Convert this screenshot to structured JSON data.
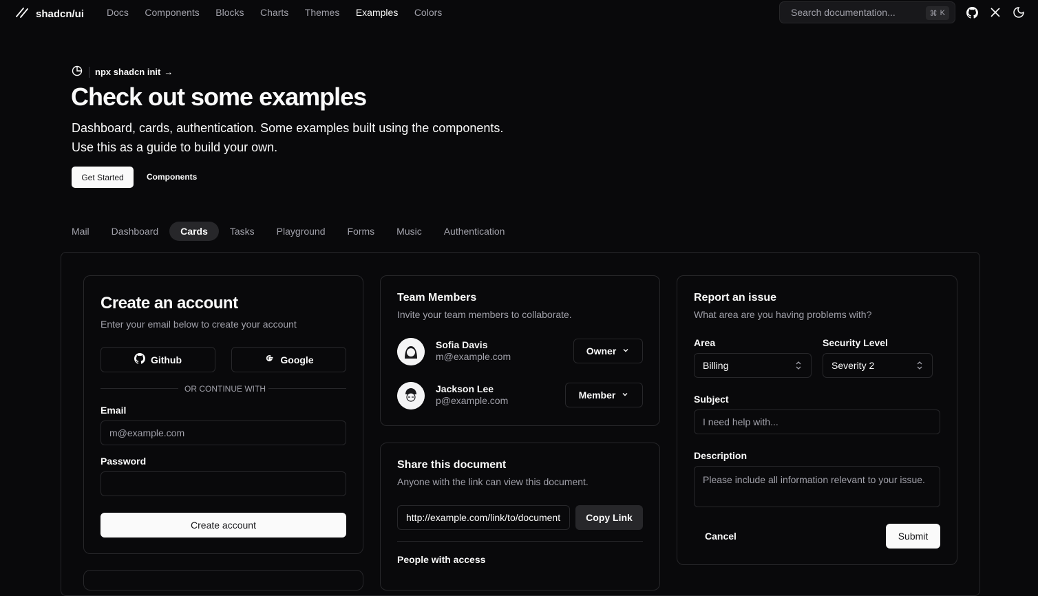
{
  "header": {
    "logo_text": "shadcn/ui",
    "nav": [
      "Docs",
      "Components",
      "Blocks",
      "Charts",
      "Themes",
      "Examples",
      "Colors"
    ],
    "active_nav": "Examples",
    "search_placeholder": "Search documentation...",
    "search_shortcut_symbol": "⌘",
    "search_shortcut_key": "K"
  },
  "hero": {
    "badge": "npx shadcn init",
    "badge_arrow": "→",
    "title": "Check out some examples",
    "description_line1": "Dashboard, cards, authentication. Some examples built using the components.",
    "description_line2": "Use this as a guide to build your own.",
    "primary_button": "Get Started",
    "secondary_button": "Components"
  },
  "tabs": [
    "Mail",
    "Dashboard",
    "Cards",
    "Tasks",
    "Playground",
    "Forms",
    "Music",
    "Authentication"
  ],
  "active_tab": "Cards",
  "create_account": {
    "title": "Create an account",
    "subtitle": "Enter your email below to create your account",
    "github_label": "Github",
    "google_label": "Google",
    "divider": "OR CONTINUE WITH",
    "email_label": "Email",
    "email_placeholder": "m@example.com",
    "password_label": "Password",
    "submit": "Create account"
  },
  "team": {
    "title": "Team Members",
    "subtitle": "Invite your team members to collaborate.",
    "members": [
      {
        "name": "Sofia Davis",
        "email": "m@example.com",
        "role": "Owner"
      },
      {
        "name": "Jackson Lee",
        "email": "p@example.com",
        "role": "Member"
      }
    ]
  },
  "share": {
    "title": "Share this document",
    "subtitle": "Anyone with the link can view this document.",
    "link_value": "http://example.com/link/to/document",
    "copy_button": "Copy Link",
    "people_heading": "People with access"
  },
  "report": {
    "title": "Report an issue",
    "subtitle": "What area are you having problems with?",
    "area_label": "Area",
    "area_value": "Billing",
    "severity_label": "Security Level",
    "severity_value": "Severity 2",
    "subject_label": "Subject",
    "subject_placeholder": "I need help with...",
    "description_label": "Description",
    "description_placeholder": "Please include all information relevant to your issue.",
    "cancel": "Cancel",
    "submit": "Submit"
  }
}
